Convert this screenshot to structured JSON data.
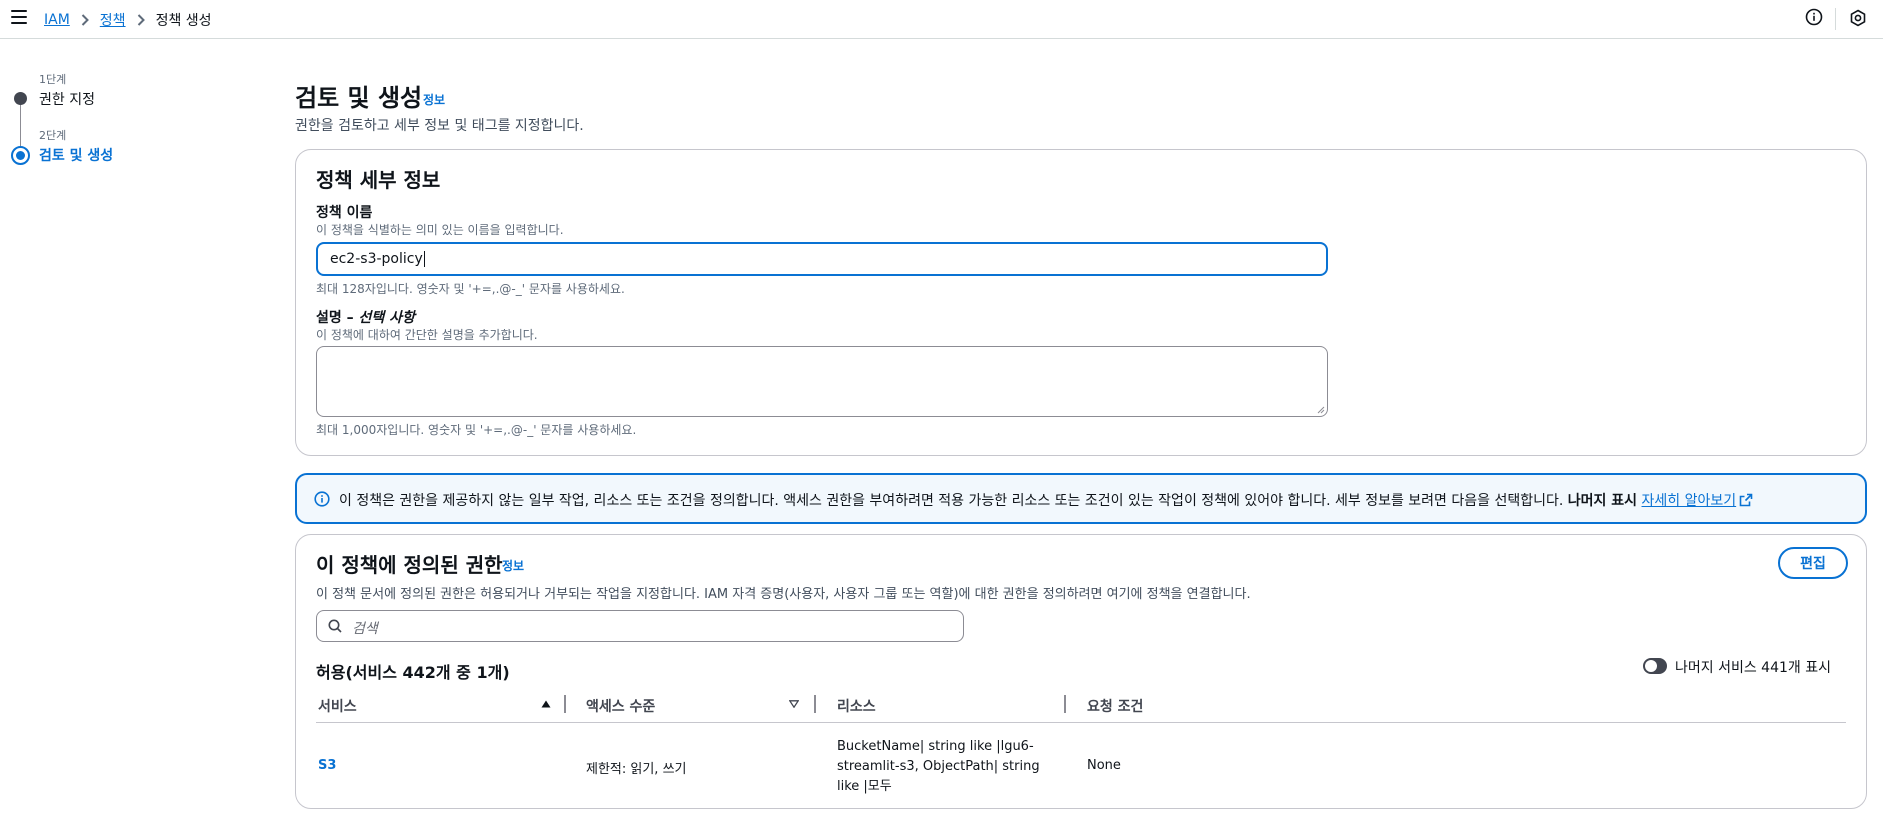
{
  "breadcrumb": {
    "items": [
      "IAM",
      "정책"
    ],
    "current": "정책 생성"
  },
  "steps": [
    {
      "number": "1단계",
      "title": "권한 지정",
      "state": "completed"
    },
    {
      "number": "2단계",
      "title": "검토 및 생성",
      "state": "active"
    }
  ],
  "header": {
    "title": "검토 및 생성",
    "info_link": "정보",
    "description": "권한을 검토하고 세부 정보 및 태그를 지정합니다."
  },
  "policy_details": {
    "heading": "정책 세부 정보",
    "name": {
      "label": "정책 이름",
      "description": "이 정책을 식별하는 의미 있는 이름을 입력합니다.",
      "value": "ec2-s3-policy",
      "constraint": "최대 128자입니다. 영숫자 및 '+=,.@-_' 문자를 사용하세요."
    },
    "description_field": {
      "label_main": "설명 – ",
      "label_optional": "선택 사항",
      "description": "이 정책에 대하여 간단한 설명을 추가합니다.",
      "value": "",
      "constraint": "최대 1,000자입니다. 영숫자 및 '+=,.@-_' 문자를 사용하세요."
    }
  },
  "alert": {
    "text": "이 정책은 권한을 제공하지 않는 일부 작업, 리소스 또는 조건을 정의합니다. 액세스 권한을 부여하려면 적용 가능한 리소스 또는 조건이 있는 작업이 정책에 있어야 합니다. 세부 정보를 보려면 다음을 선택합니다.",
    "bold": "나머지 표시",
    "link": "자세히 알아보기"
  },
  "permissions": {
    "heading": "이 정책에 정의된 권한",
    "info_link": "정보",
    "edit_label": "편집",
    "description": "이 정책 문서에 정의된 권한은 허용되거나 거부되는 작업을 지정합니다. IAM 자격 증명(사용자, 사용자 그룹 또는 역할)에 대한 권한을 정의하려면 여기에 정책을 연결합니다.",
    "search_placeholder": "검색",
    "allow_title": "허용(서비스 442개 중 1개)",
    "toggle_label": "나머지 서비스 441개 표시",
    "toggle_on": false,
    "columns": [
      "서비스",
      "액세스 수준",
      "리소스",
      "요청 조건"
    ],
    "rows": [
      {
        "service": "S3",
        "access": "제한적: 읽기, 쓰기",
        "resource_lines": [
          "BucketName| string like |lgu6-",
          "streamlit-s3, ObjectPath| string",
          "like |모두"
        ],
        "condition": "None"
      }
    ]
  },
  "colors": {
    "accent": "#0972d3",
    "text": "#0f141a",
    "muted": "#5f6b7a",
    "alert_bg": "#f2f8fd"
  },
  "icons": {
    "menu": "hamburger-icon",
    "info": "info-circle-icon",
    "settings": "hexagon-gear-icon",
    "search": "search-icon",
    "external": "external-link-icon"
  }
}
